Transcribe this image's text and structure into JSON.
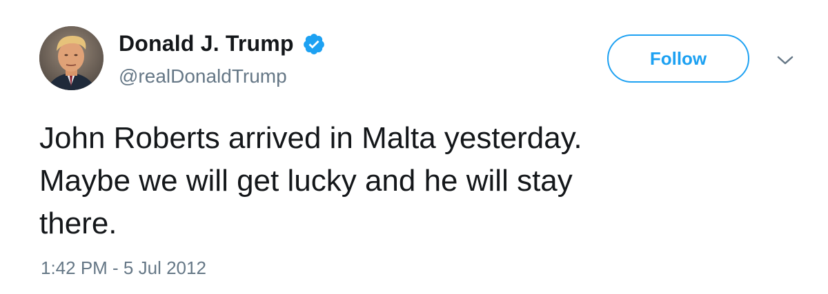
{
  "author": {
    "name": "Donald J. Trump",
    "handle": "@realDonaldTrump",
    "verified": true,
    "avatar_icon": "profile-photo"
  },
  "actions": {
    "follow_label": "Follow",
    "menu_icon": "chevron-down-icon"
  },
  "tweet": {
    "lines": [
      "John Roberts arrived in Malta yesterday.",
      "Maybe we will get lucky and he will stay",
      "there."
    ]
  },
  "meta": {
    "timestamp": "1:42 PM - 5 Jul 2012"
  },
  "colors": {
    "accent": "#1da1f2",
    "text_primary": "#14171a",
    "text_secondary": "#657786",
    "background": "#ffffff"
  }
}
